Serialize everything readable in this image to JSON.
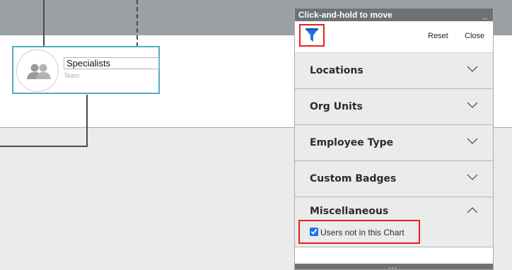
{
  "panel": {
    "title": "Click-and-hold to move",
    "minimize": "_",
    "reset_label": "Reset",
    "close_label": "Close",
    "sections": [
      {
        "label": "Locations"
      },
      {
        "label": "Org Units"
      },
      {
        "label": "Employee Type"
      },
      {
        "label": "Custom Badges"
      }
    ],
    "misc": {
      "label": "Miscellaneous",
      "option_label": "Users not in this Chart",
      "option_checked": true
    },
    "footer_dots": "..."
  },
  "node": {
    "name": "Specialists",
    "type": "Team"
  },
  "colors": {
    "highlight": "#e2231a",
    "filter_icon": "#1a73e8",
    "node_border": "#5aa7cf"
  }
}
